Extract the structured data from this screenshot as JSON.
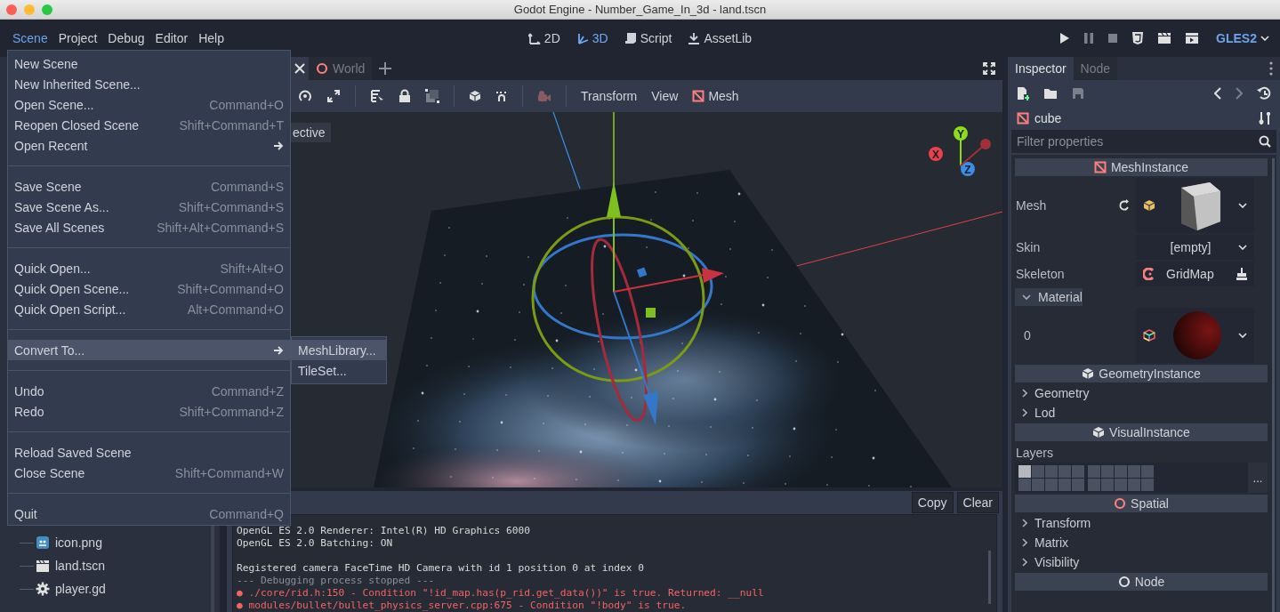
{
  "window": {
    "title": "Godot Engine - Number_Game_In_3d - land.tscn"
  },
  "menu_bar": [
    {
      "label": "Scene",
      "selected": true
    },
    {
      "label": "Project",
      "selected": false
    },
    {
      "label": "Debug",
      "selected": false
    },
    {
      "label": "Editor",
      "selected": false
    },
    {
      "label": "Help",
      "selected": false
    }
  ],
  "workspaces": [
    {
      "kind": "planar",
      "label": "2D",
      "selected": false
    },
    {
      "kind": "spatial",
      "label": "3D",
      "selected": true
    },
    {
      "kind": "script",
      "label": "Script",
      "selected": false
    },
    {
      "kind": "assetlib",
      "label": "AssetLib",
      "selected": false
    }
  ],
  "renderer": "GLES2",
  "scene_menu": [
    {
      "kind": "item",
      "label": "New Scene",
      "selected": false
    },
    {
      "kind": "item",
      "label": "New Inherited Scene...",
      "selected": false
    },
    {
      "kind": "item",
      "label": "Open Scene...",
      "shortcut": "Command+O",
      "selected": false
    },
    {
      "kind": "item",
      "label": "Reopen Closed Scene",
      "shortcut": "Shift+Command+T",
      "selected": false
    },
    {
      "kind": "submenu",
      "label": "Open Recent",
      "selected": false
    },
    {
      "kind": "separator"
    },
    {
      "kind": "item",
      "label": "Save Scene",
      "shortcut": "Command+S",
      "selected": false
    },
    {
      "kind": "item",
      "label": "Save Scene As...",
      "shortcut": "Shift+Command+S",
      "selected": false
    },
    {
      "kind": "item",
      "label": "Save All Scenes",
      "shortcut": "Shift+Alt+Command+S",
      "selected": false
    },
    {
      "kind": "separator"
    },
    {
      "kind": "item",
      "label": "Quick Open...",
      "shortcut": "Shift+Alt+O",
      "selected": false
    },
    {
      "kind": "item",
      "label": "Quick Open Scene...",
      "shortcut": "Shift+Command+O",
      "selected": false
    },
    {
      "kind": "item",
      "label": "Quick Open Script...",
      "shortcut": "Alt+Command+O",
      "selected": false
    },
    {
      "kind": "separator"
    },
    {
      "kind": "submenu",
      "label": "Convert To...",
      "selected": true
    },
    {
      "kind": "separator"
    },
    {
      "kind": "item",
      "label": "Undo",
      "shortcut": "Command+Z",
      "selected": false
    },
    {
      "kind": "item",
      "label": "Redo",
      "shortcut": "Shift+Command+Z",
      "selected": false
    },
    {
      "kind": "separator"
    },
    {
      "kind": "item",
      "label": "Reload Saved Scene",
      "selected": false
    },
    {
      "kind": "item",
      "label": "Close Scene",
      "shortcut": "Shift+Command+W",
      "selected": false
    },
    {
      "kind": "separator"
    },
    {
      "kind": "item",
      "label": "Quit",
      "shortcut": "Command+Q",
      "selected": false
    }
  ],
  "convert_submenu": [
    {
      "label": "MeshLibrary...",
      "selected": true
    },
    {
      "label": "TileSet...",
      "selected": false
    }
  ],
  "filesystem": [
    {
      "kind": "image",
      "name": "icon.png"
    },
    {
      "kind": "scene",
      "name": "land.tscn"
    },
    {
      "kind": "script",
      "name": "player.gd"
    }
  ],
  "scene_tabs": [
    {
      "selected": true
    },
    {
      "label": "World",
      "selected": false
    }
  ],
  "viewport": {
    "view_label": "ective",
    "menus": [
      {
        "kind": "plain",
        "label": "Transform"
      },
      {
        "kind": "plain",
        "label": "View"
      },
      {
        "kind": "mesh",
        "label": "Mesh"
      }
    ],
    "axis_labels": [
      "X",
      "Y",
      "Z"
    ]
  },
  "output": {
    "buttons": [
      "Copy",
      "Clear"
    ],
    "lines": [
      {
        "kind": "info",
        "text": "OpenGL ES 2.0 Renderer: Intel(R) HD Graphics 6000"
      },
      {
        "kind": "info",
        "text": "OpenGL ES 2.0 Batching: ON"
      },
      {
        "kind": "blank"
      },
      {
        "kind": "info",
        "text": "Registered camera FaceTime HD Camera with id 1 position 0 at index 0"
      },
      {
        "kind": "muted",
        "text": "--- Debugging process stopped ---"
      },
      {
        "kind": "error",
        "text": "● ./core/rid.h:150 - Condition \"!id_map.has(p_rid.get_data())\" is true. Returned: __null"
      },
      {
        "kind": "error",
        "text": "● modules/bullet/bullet_physics_server.cpp:675 - Condition \"!body\" is true."
      }
    ]
  },
  "inspector": {
    "tabs": [
      {
        "label": "Inspector",
        "selected": true
      },
      {
        "label": "Node",
        "selected": false
      }
    ],
    "object": "cube",
    "filter_placeholder": "Filter properties",
    "rows": [
      {
        "kind": "meshheader",
        "color": "#fc7f7f",
        "label": "MeshInstance"
      },
      {
        "kind": "mesh",
        "label": "Mesh"
      },
      {
        "kind": "dropdown",
        "label": "Skin",
        "value": "[empty]"
      },
      {
        "kind": "nodepath",
        "label": "Skeleton",
        "value": "GridMap"
      },
      {
        "kind": "group",
        "label": "Material",
        "expanded": true
      },
      {
        "kind": "material",
        "label": "0"
      },
      {
        "kind": "cubeheader",
        "color": "#e0e0e0",
        "label": "GeometryInstance"
      },
      {
        "kind": "group",
        "label": "Geometry",
        "expanded": false
      },
      {
        "kind": "group",
        "label": "Lod",
        "expanded": false
      },
      {
        "kind": "cubeheader",
        "color": "#e0e0e0",
        "label": "VisualInstance"
      },
      {
        "kind": "layers",
        "label": "Layers",
        "button": "...",
        "cells": [
          {
            "on": true
          },
          {
            "on": false
          },
          {
            "on": false
          },
          {
            "on": false
          },
          {
            "on": false
          },
          {
            "on": false
          },
          {
            "on": false
          },
          {
            "on": false
          },
          {
            "on": false
          },
          {
            "on": false
          },
          {
            "on": false
          },
          {
            "on": false
          },
          {
            "on": false
          },
          {
            "on": false
          },
          {
            "on": false
          },
          {
            "on": false
          },
          {
            "on": false
          },
          {
            "on": false
          },
          {
            "on": false
          },
          {
            "on": false
          }
        ]
      },
      {
        "kind": "ringheader",
        "color": "#fc7f7f",
        "label": "Spatial"
      },
      {
        "kind": "group",
        "label": "Transform",
        "expanded": false
      },
      {
        "kind": "group",
        "label": "Matrix",
        "expanded": false
      },
      {
        "kind": "group",
        "label": "Visibility",
        "expanded": false
      },
      {
        "kind": "ringheader",
        "color": "#e0e0e0",
        "label": "Node"
      }
    ]
  }
}
